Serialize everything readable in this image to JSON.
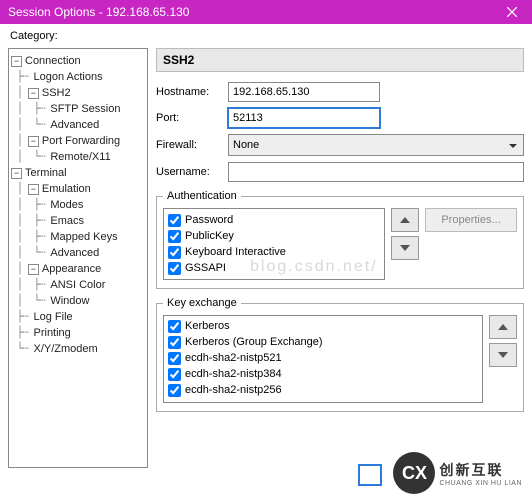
{
  "title": "Session Options - 192.168.65.130",
  "categoryLabel": "Category:",
  "tree": {
    "connection": "Connection",
    "logonActions": "Logon Actions",
    "ssh2": "SSH2",
    "sftp": "SFTP Session",
    "advanced1": "Advanced",
    "portFwd": "Port Forwarding",
    "remoteX11": "Remote/X11",
    "terminal": "Terminal",
    "emulation": "Emulation",
    "modes": "Modes",
    "emacs": "Emacs",
    "mapped": "Mapped Keys",
    "advanced2": "Advanced",
    "appearance": "Appearance",
    "ansi": "ANSI Color",
    "window": "Window",
    "logfile": "Log File",
    "printing": "Printing",
    "zmodem": "X/Y/Zmodem"
  },
  "header": "SSH2",
  "labels": {
    "hostname": "Hostname:",
    "port": "Port:",
    "firewall": "Firewall:",
    "username": "Username:",
    "auth": "Authentication",
    "kex": "Key exchange",
    "properties": "Properties..."
  },
  "values": {
    "hostname": "192.168.65.130",
    "port": "52113",
    "firewall": "None",
    "username": ""
  },
  "authMethods": [
    "Password",
    "PublicKey",
    "Keyboard Interactive",
    "GSSAPI"
  ],
  "kexMethods": [
    "Kerberos",
    "Kerberos (Group Exchange)",
    "ecdh-sha2-nistp521",
    "ecdh-sha2-nistp384",
    "ecdh-sha2-nistp256"
  ],
  "watermark": "blog.csdn.net/",
  "logo": {
    "cn": "创新互联",
    "py": "CHUANG XIN HU LIAN"
  }
}
